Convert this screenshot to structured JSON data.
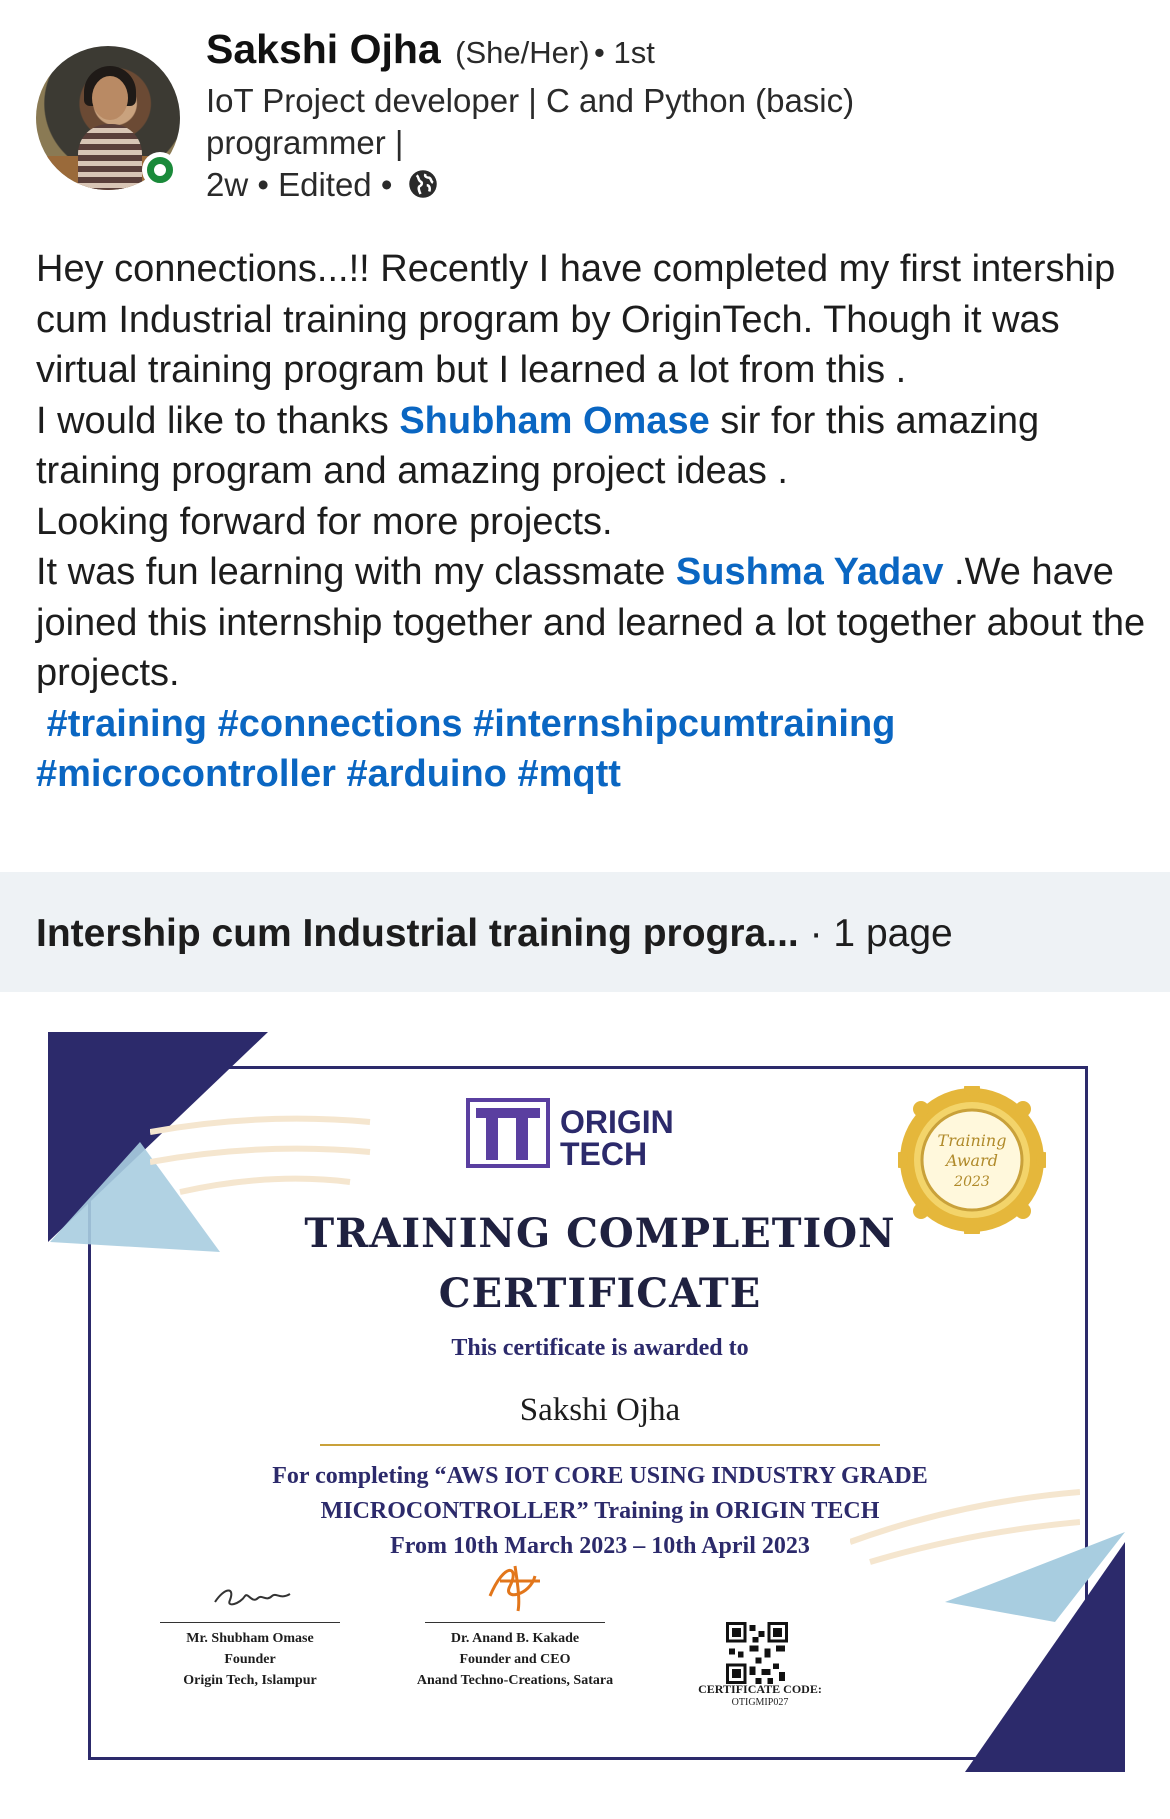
{
  "author": {
    "name": "Sakshi Ojha",
    "pronouns": "(She/Her)",
    "connection": "• 1st",
    "headline": "IoT Project developer | C and Python (basic) programmer |",
    "time": "2w",
    "edited": "• Edited •",
    "visibility_icon": "globe-icon",
    "status_color": "#1a8a3a"
  },
  "post": {
    "p1": "Hey connections...!! Recently I have completed my first intership cum Industrial training program by OriginTech. Though it was virtual training program but I learned a lot from this .",
    "p2_before": "I would like to thanks ",
    "mention1": "Shubham Omase",
    "p2_after": " sir for this amazing training program and amazing project ideas .",
    "p3": "Looking forward for more projects.",
    "p4_before": "It was fun learning with my classmate ",
    "mention2": "Sushma Yadav",
    "p4_after": "  .We have joined this internship together and learned a lot together about the projects.",
    "hashtags": [
      "#training",
      "#connections",
      "#internshipcumtraining",
      "#microcontroller",
      "#arduino",
      "#mqtt"
    ],
    "link_color": "#0a66c2"
  },
  "document": {
    "title": "Intership cum Industrial training progra...",
    "pages": "· 1 page"
  },
  "certificate": {
    "logo_line1": "ORIGIN",
    "logo_line2": "TECH",
    "title_line1": "TRAINING COMPLETION",
    "title_line2": "CERTIFICATE",
    "awarded_to": "This certificate is awarded to",
    "recipient": "Sakshi Ojha",
    "for_line1": "For completing “AWS IOT CORE USING INDUSTRY GRADE",
    "for_line2": "MICROCONTROLLER” Training in ORIGIN TECH",
    "for_line3": "From 10th March 2023 – 10th April 2023",
    "seal_line1": "Training",
    "seal_line2": "Award",
    "seal_line3": "2023",
    "sig1_name": "Mr. Shubham Omase",
    "sig1_role": "Founder",
    "sig1_org": "Origin Tech, Islampur",
    "sig2_name": "Dr. Anand B. Kakade",
    "sig2_role": "Founder and CEO",
    "sig2_org": "Anand Techno-Creations, Satara",
    "code_label": "CERTIFICATE CODE:",
    "code_value": "OTIGMIP027",
    "colors": {
      "navy": "#2c2a6b",
      "light_blue": "#a8cde0",
      "gold": "#c9a13a"
    }
  }
}
